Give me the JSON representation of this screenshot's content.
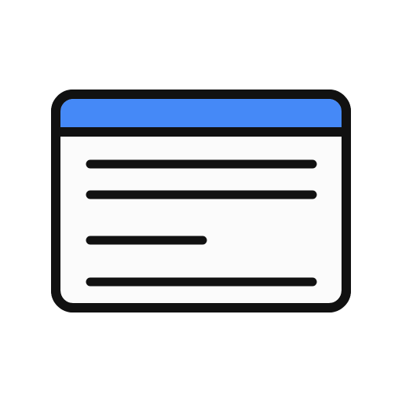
{
  "icon": {
    "name": "document-window-icon",
    "colors": {
      "background": "#ffffff",
      "outline": "#111111",
      "title_bar": "#4589f7",
      "body": "#fbfbfb"
    },
    "text_lines": [
      {
        "id": "line-1",
        "length": "full"
      },
      {
        "id": "line-2",
        "length": "full"
      },
      {
        "id": "line-3",
        "length": "short"
      },
      {
        "id": "line-4",
        "length": "full"
      }
    ]
  }
}
